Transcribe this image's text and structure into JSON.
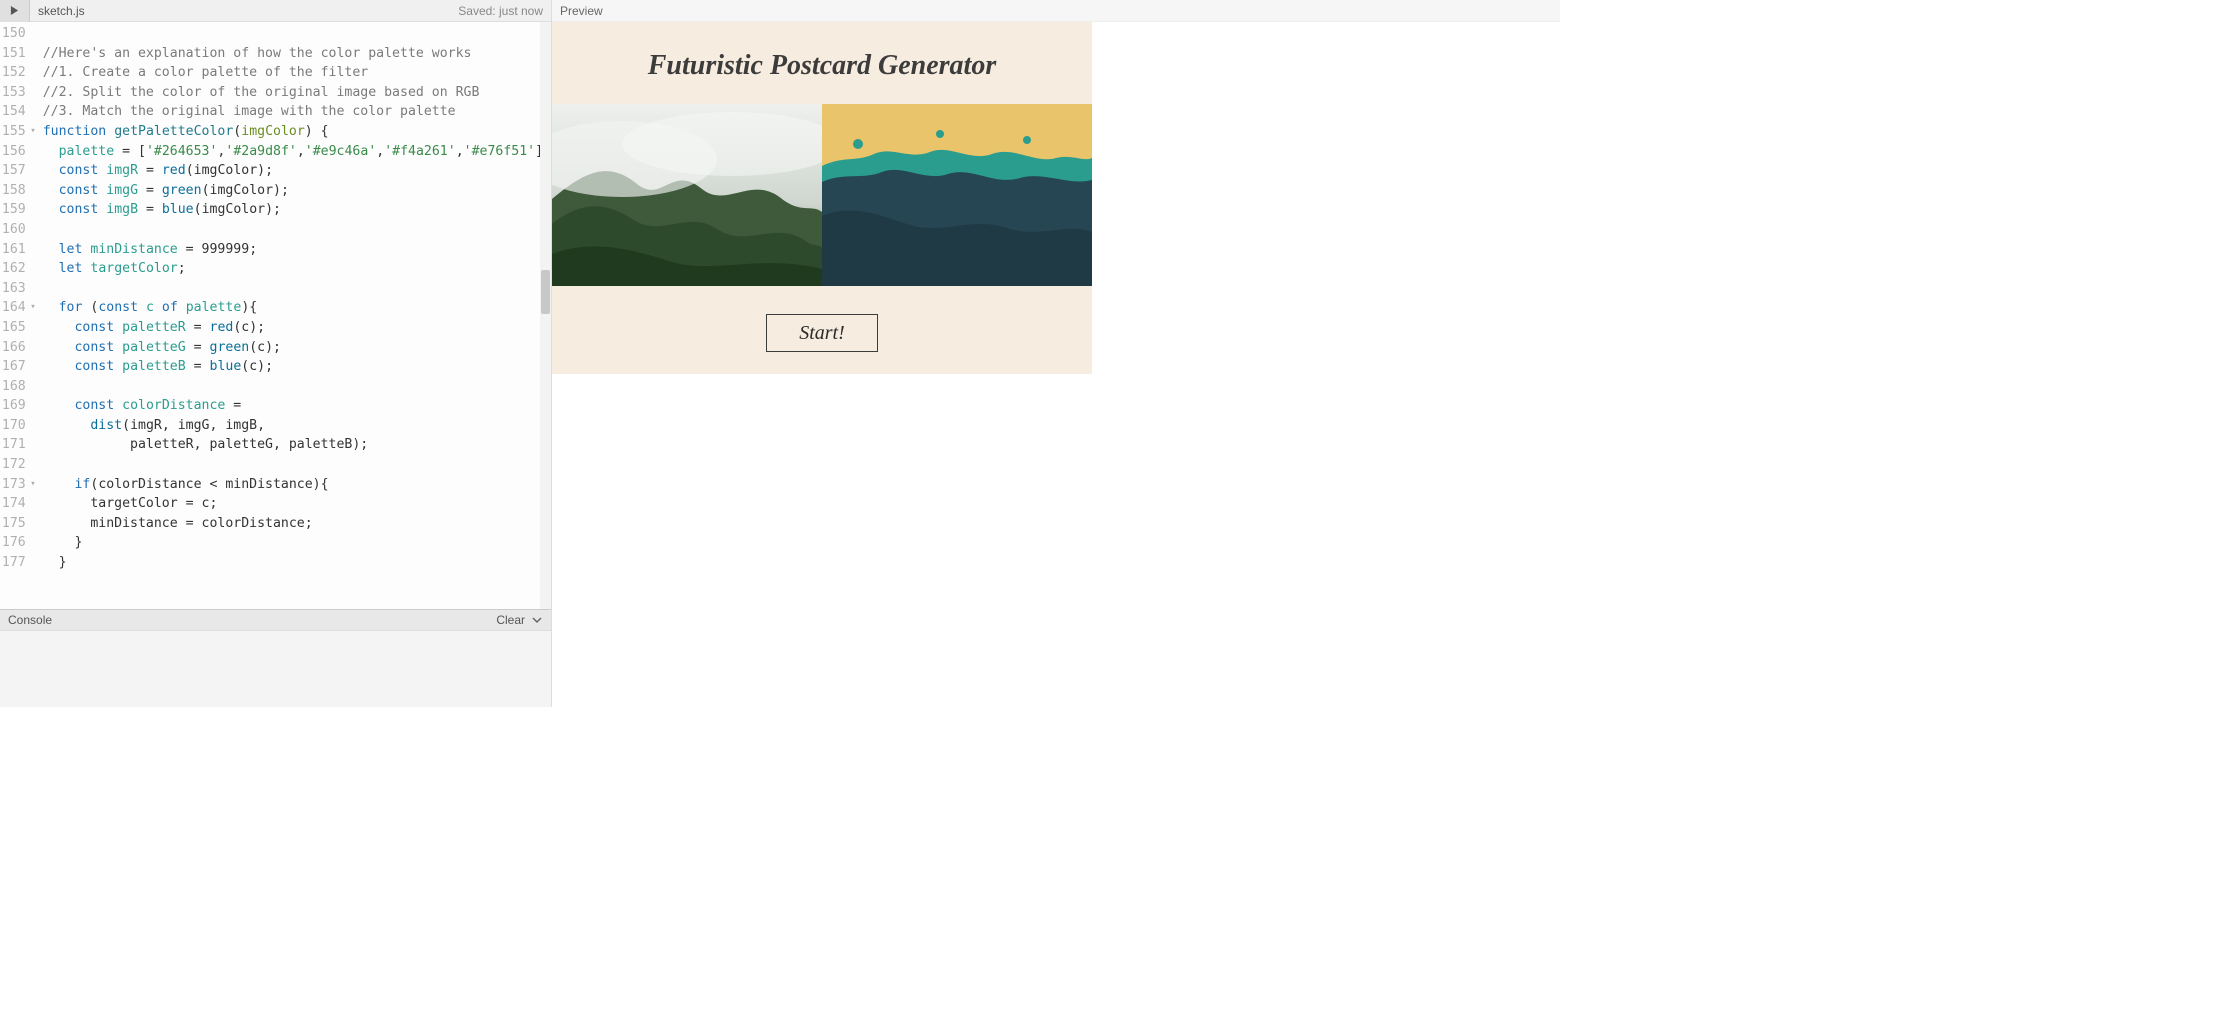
{
  "editor": {
    "filename": "sketch.js",
    "saved_label": "Saved: just now",
    "console_label": "Console",
    "clear_label": "Clear",
    "highlighted_line": 156,
    "lines": [
      {
        "n": 150,
        "html": ""
      },
      {
        "n": 151,
        "html": "<span class='tok-comment'>//Here's an explanation of how the color palette works</span>"
      },
      {
        "n": 152,
        "html": "<span class='tok-comment'>//1. Create a color palette of the filter</span>"
      },
      {
        "n": 153,
        "html": "<span class='tok-comment'>//2. Split the color of the original image based on RGB</span>"
      },
      {
        "n": 154,
        "html": "<span class='tok-comment'>//3. Match the original image with the color palette</span>"
      },
      {
        "n": 155,
        "fold": true,
        "html": "<span class='tok-kw'>function</span> <span class='tok-fn'>getPaletteColor</span>(<span class='tok-var'>imgColor</span>) {"
      },
      {
        "n": 156,
        "html": "  <span class='tok-teal'>palette</span> = [<span class='tok-str'>'#264653'</span>,<span class='tok-str'>'#2a9d8f'</span>,<span class='tok-str'>'#e9c46a'</span>,<span class='tok-str'>'#f4a261'</span>,<span class='tok-str'>'#e76f51'</span>];"
      },
      {
        "n": 157,
        "html": "  <span class='tok-kw'>const</span> <span class='tok-teal'>imgR</span> = <span class='tok-builtin'>red</span>(imgColor);"
      },
      {
        "n": 158,
        "html": "  <span class='tok-kw'>const</span> <span class='tok-teal'>imgG</span> = <span class='tok-builtin'>green</span>(imgColor);"
      },
      {
        "n": 159,
        "html": "  <span class='tok-kw'>const</span> <span class='tok-teal'>imgB</span> = <span class='tok-builtin'>blue</span>(imgColor);"
      },
      {
        "n": 160,
        "html": ""
      },
      {
        "n": 161,
        "html": "  <span class='tok-kw'>let</span> <span class='tok-teal'>minDistance</span> = 999999;"
      },
      {
        "n": 162,
        "html": "  <span class='tok-kw'>let</span> <span class='tok-teal'>targetColor</span>;"
      },
      {
        "n": 163,
        "html": ""
      },
      {
        "n": 164,
        "fold": true,
        "html": "  <span class='tok-kw'>for</span> (<span class='tok-kw'>const</span> <span class='tok-teal'>c</span> <span class='tok-kw'>of</span> <span class='tok-teal'>palette</span>){"
      },
      {
        "n": 165,
        "html": "    <span class='tok-kw'>const</span> <span class='tok-teal'>paletteR</span> = <span class='tok-builtin'>red</span>(c);"
      },
      {
        "n": 166,
        "html": "    <span class='tok-kw'>const</span> <span class='tok-teal'>paletteG</span> = <span class='tok-builtin'>green</span>(c);"
      },
      {
        "n": 167,
        "html": "    <span class='tok-kw'>const</span> <span class='tok-teal'>paletteB</span> = <span class='tok-builtin'>blue</span>(c);"
      },
      {
        "n": 168,
        "html": ""
      },
      {
        "n": 169,
        "html": "    <span class='tok-kw'>const</span> <span class='tok-teal'>colorDistance</span> ="
      },
      {
        "n": 170,
        "html": "      <span class='tok-builtin'>dist</span>(imgR, imgG, imgB,"
      },
      {
        "n": 171,
        "html": "           paletteR, paletteG, paletteB);"
      },
      {
        "n": 172,
        "html": ""
      },
      {
        "n": 173,
        "fold": true,
        "html": "    <span class='tok-kw'>if</span>(colorDistance &lt; minDistance){"
      },
      {
        "n": 174,
        "html": "      targetColor = c;"
      },
      {
        "n": 175,
        "html": "      minDistance = colorDistance;"
      },
      {
        "n": 176,
        "html": "    }"
      },
      {
        "n": 177,
        "html": "  }"
      }
    ]
  },
  "preview": {
    "header_label": "Preview",
    "app_title": "Futuristic Postcard Generator",
    "start_label": "Start!",
    "palette": [
      "#264653",
      "#2a9d8f",
      "#e9c46a",
      "#f4a261",
      "#e76f51"
    ]
  }
}
